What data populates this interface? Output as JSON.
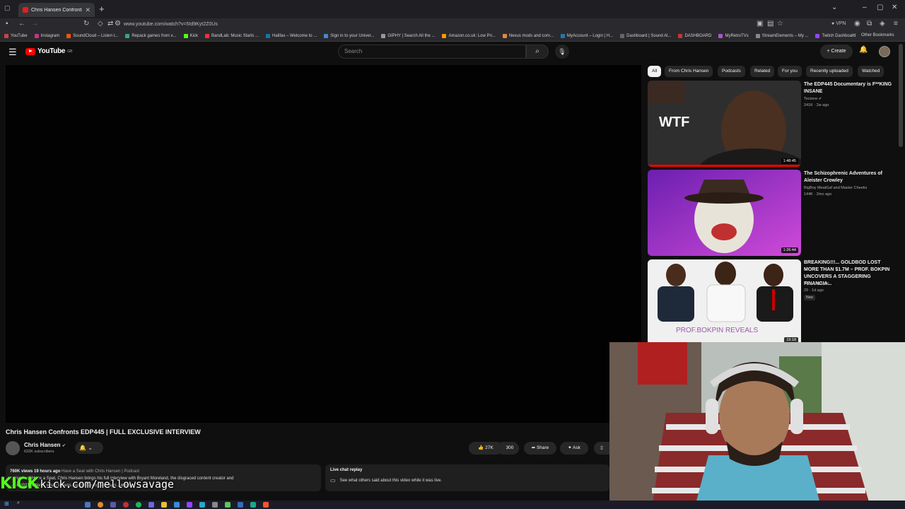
{
  "browser": {
    "tab_title": "Chris Hansen Confronts EDP445",
    "url": "www.youtube.com/watch?v=5Id9Kyt2Z0Us",
    "vpn_label": "VPN",
    "bookmarks": [
      "YouTube",
      "Instagram",
      "SoundCloud – Listen t...",
      "Repack games from x...",
      "Kick",
      "BandLab: Music Starts ...",
      "Halifax – Welcome to ...",
      "Sign in to your Univer...",
      "GIPHY | Search All the ...",
      "Amazon.co.uk: Low Pri...",
      "Nexus mods and com...",
      "MyAccount – Login | H...",
      "Dashboard | Sound Al...",
      "DASHBOARD",
      "MyRetroTVs",
      "StreamElements – My ...",
      "Twitch Dashboard"
    ],
    "other_bookmarks": "Other Bookmarks"
  },
  "youtube": {
    "logo_text": "YouTube",
    "logo_region": "GB",
    "search_placeholder": "Search",
    "create_label": "Create"
  },
  "video": {
    "title": "Chris Hansen Confronts EDP445 | FULL EXCLUSIVE INTERVIEW",
    "channel": "Chris Hansen",
    "subscribers": "632K subscribers",
    "likes": "27K",
    "dislikes": "300",
    "share_label": "Share",
    "ask_label": "Ask",
    "views": "760K views",
    "age": "19 hours ago",
    "playlist": "Have a Seat with Chris Hansen | Podcast",
    "desc_line1": "...pisode of Have a Seat, Chris Hansen brings his full interview with Bryant Moreland, the disgraced content creator and",
    "desc_line2": "...his 2021 actions, when he was caught having an inapp",
    "more_label": "...more",
    "live_chat_title": "Live chat replay",
    "live_chat_text": "See what others said about this video while it was live."
  },
  "chips": [
    "All",
    "From Chris Hansen",
    "Podcasts",
    "Related",
    "For you",
    "Recently uploaded",
    "Watched"
  ],
  "recommendations": [
    {
      "title": "The EDP445 Documentary is F**KING INSANE",
      "channel": "Tectone",
      "meta": "241K · 2w ago",
      "duration": "1:48:45",
      "thumb_text": "WTF"
    },
    {
      "title": "The Schizophrenic Adventures of Aleister Crowley",
      "channel": "BigBoy MeatGaf  and Master Cheeks",
      "meta": "144K · 2mo ago",
      "duration": "1:26:44",
      "thumb_text": ""
    },
    {
      "title": "BREAKING!!!... GOLDBOD LOST MORE THAN $1.7M – PROF. BOKPIN UNCOVERS A STAGGERING FINANCIA...",
      "channel": "FMS TRENDS",
      "meta": "29 · 1d ago",
      "badge": "New",
      "duration": "19:18",
      "thumb_text": "PROF.BOKPIN REVEALS"
    }
  ],
  "overlay": {
    "kick_logo": "KICK",
    "kick_url": "kick.com/mellowsavage"
  },
  "colors": {
    "youtube_red": "#ff0000",
    "kick_green": "#53fc18",
    "background": "#0f0f0f"
  }
}
